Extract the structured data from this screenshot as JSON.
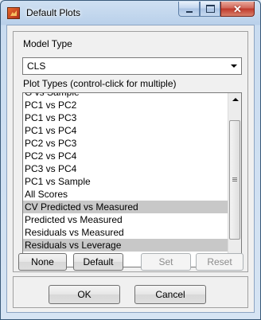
{
  "window": {
    "title": "Default Plots",
    "app_icon": "matlab-icon",
    "controls": {
      "minimize": "minimize-icon",
      "maximize": "maximize-icon",
      "close": "close-icon"
    }
  },
  "model_type": {
    "label": "Model Type",
    "selected": "CLS"
  },
  "plot_types": {
    "label": "Plot Types (control-click for multiple)",
    "items": [
      {
        "label": "G vs Sample",
        "selected": false
      },
      {
        "label": "PC1 vs PC2",
        "selected": false
      },
      {
        "label": "PC1 vs PC3",
        "selected": false
      },
      {
        "label": "PC1 vs PC4",
        "selected": false
      },
      {
        "label": "PC2 vs PC3",
        "selected": false
      },
      {
        "label": "PC2 vs PC4",
        "selected": false
      },
      {
        "label": "PC3 vs PC4",
        "selected": false
      },
      {
        "label": "PC1 vs Sample",
        "selected": false
      },
      {
        "label": "All Scores",
        "selected": false
      },
      {
        "label": "CV Predicted vs Measured",
        "selected": true
      },
      {
        "label": "Predicted vs Measured",
        "selected": false
      },
      {
        "label": "Residuals vs Measured",
        "selected": false
      },
      {
        "label": "Residuals vs Leverage",
        "selected": true
      }
    ]
  },
  "list_buttons": {
    "none": "None",
    "default": "Default",
    "set": "Set",
    "reset": "Reset"
  },
  "dialog_buttons": {
    "ok": "OK",
    "cancel": "Cancel"
  },
  "colors": {
    "selection": "#c8c8c8",
    "titlebar": "#b9d0ea",
    "dialog_bg": "#f0f0f0",
    "close_button": "#c0392b"
  }
}
